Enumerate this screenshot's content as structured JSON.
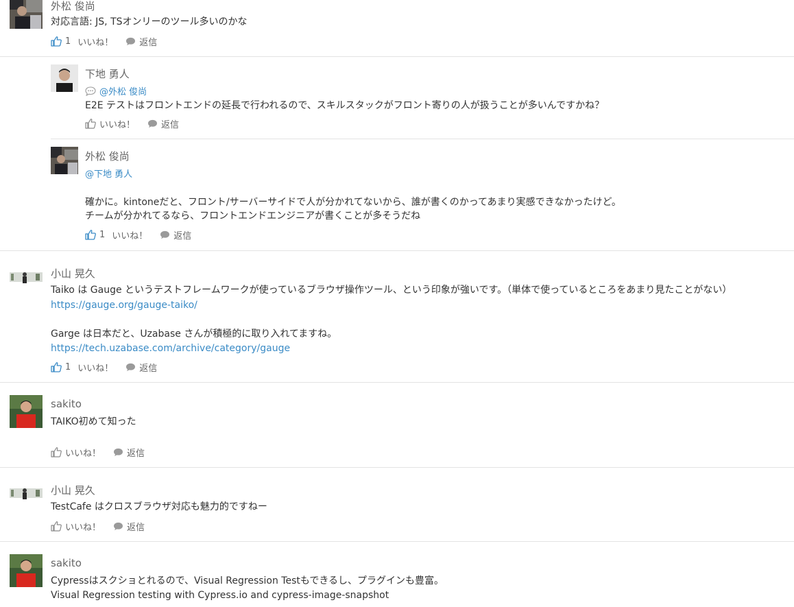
{
  "ui": {
    "like_label": "いいね！",
    "reply_label": "返信"
  },
  "colors": {
    "link": "#3a8bc6",
    "divider": "#e3e3e3",
    "author": "#666666",
    "text": "#333333"
  },
  "comments": [
    {
      "author": "外松 俊尚",
      "lines": [
        "対応言語: JS, TSオンリーのツール多いのかな"
      ],
      "like_count": "1",
      "liked": true,
      "replies": [
        {
          "author": "下地 勇人",
          "mention": "@外松 俊尚",
          "lines": [
            "E2E テストはフロントエンドの延長で行われるので、スキルスタックがフロント寄りの人が扱うことが多いんですかね？"
          ],
          "like_count": "",
          "liked": false
        },
        {
          "author": "外松 俊尚",
          "mention": "@下地 勇人",
          "lines": [
            "確かに。kintoneだと、フロント/サーバーサイドで人が分かれてないから、誰が書くのかってあまり実感できなかったけど。",
            "チームが分かれてるなら、フロントエンドエンジニアが書くことが多そうだね"
          ],
          "like_count": "1",
          "liked": true
        }
      ]
    },
    {
      "author": "小山 晃久",
      "lines": [
        "Taiko は Gauge というテストフレームワークが使っているブラウザ操作ツール、という印象が強いです。（単体で使っているところをあまり見たことがない）",
        "https://gauge.org/gauge-taiko/",
        "Garge は日本だと、Uzabase さんが積極的に取り入れてますね。",
        "https://tech.uzabase.com/archive/category/gauge"
      ],
      "like_count": "1",
      "liked": true
    },
    {
      "author": "sakito",
      "lines": [
        "TAIKO初めて知った"
      ],
      "like_count": "",
      "liked": false
    },
    {
      "author": "小山 晃久",
      "lines": [
        "TestCafe はクロスブラウザ対応も魅力的ですねー"
      ],
      "like_count": "",
      "liked": false
    },
    {
      "author": "sakito",
      "lines": [
        "Cypressはスクショとれるので、Visual Regression Testもできるし、プラグインも豊富。",
        "Visual Regression testing with Cypress.io and cypress-image-snapshot"
      ],
      "like_count": "",
      "liked": false
    }
  ]
}
